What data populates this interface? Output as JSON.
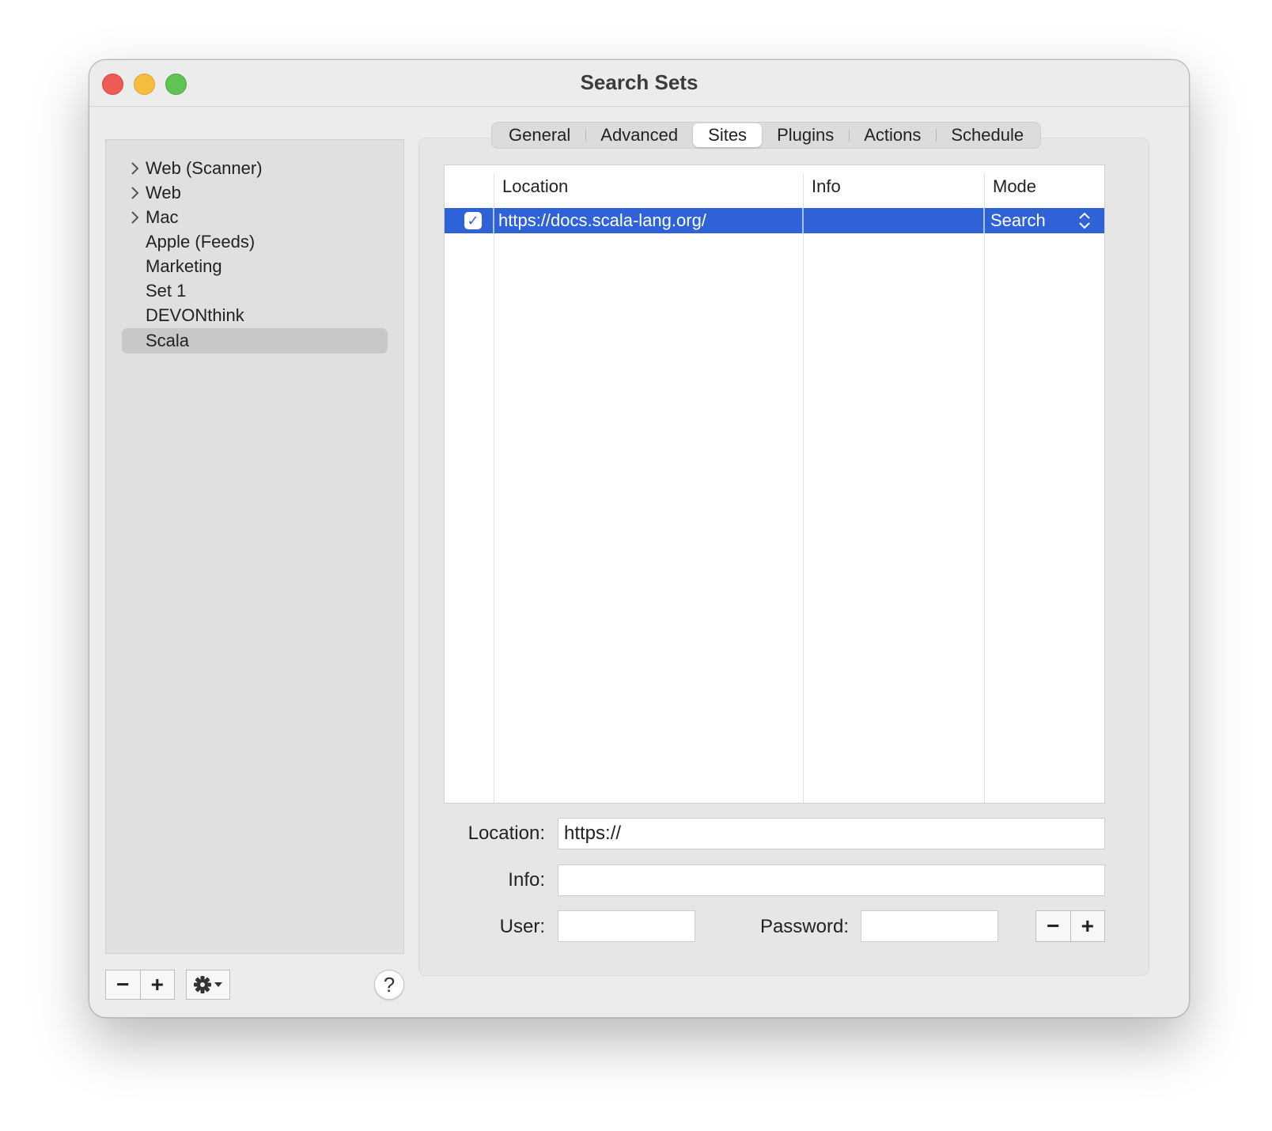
{
  "window": {
    "title": "Search Sets"
  },
  "sidebar": {
    "items": [
      {
        "label": "Web (Scanner)",
        "expandable": true,
        "selected": false
      },
      {
        "label": "Web",
        "expandable": true,
        "selected": false
      },
      {
        "label": "Mac",
        "expandable": true,
        "selected": false
      },
      {
        "label": "Apple (Feeds)",
        "expandable": false,
        "selected": false
      },
      {
        "label": "Marketing",
        "expandable": false,
        "selected": false
      },
      {
        "label": "Set 1",
        "expandable": false,
        "selected": false
      },
      {
        "label": "DEVONthink",
        "expandable": false,
        "selected": false
      },
      {
        "label": "Scala",
        "expandable": false,
        "selected": true
      }
    ],
    "remove_label": "−",
    "add_label": "+",
    "action_icon": "gear-icon",
    "help_label": "?"
  },
  "tabs": [
    {
      "label": "General",
      "active": false
    },
    {
      "label": "Advanced",
      "active": false
    },
    {
      "label": "Sites",
      "active": true
    },
    {
      "label": "Plugins",
      "active": false
    },
    {
      "label": "Actions",
      "active": false
    },
    {
      "label": "Schedule",
      "active": false
    }
  ],
  "table": {
    "headers": {
      "location": "Location",
      "info": "Info",
      "mode": "Mode"
    },
    "rows": [
      {
        "checked": true,
        "location": "https://docs.scala-lang.org/",
        "info": "",
        "mode": "Search",
        "selected": true
      }
    ]
  },
  "form": {
    "location_label": "Location:",
    "location_value": "https://",
    "info_label": "Info:",
    "info_value": "",
    "user_label": "User:",
    "user_value": "",
    "password_label": "Password:",
    "password_value": "",
    "remove_label": "−",
    "add_label": "+"
  },
  "colors": {
    "selection": "#2e62d6",
    "close": "#ee5b55",
    "minimize": "#f5bd3d",
    "zoom": "#5fc453"
  }
}
